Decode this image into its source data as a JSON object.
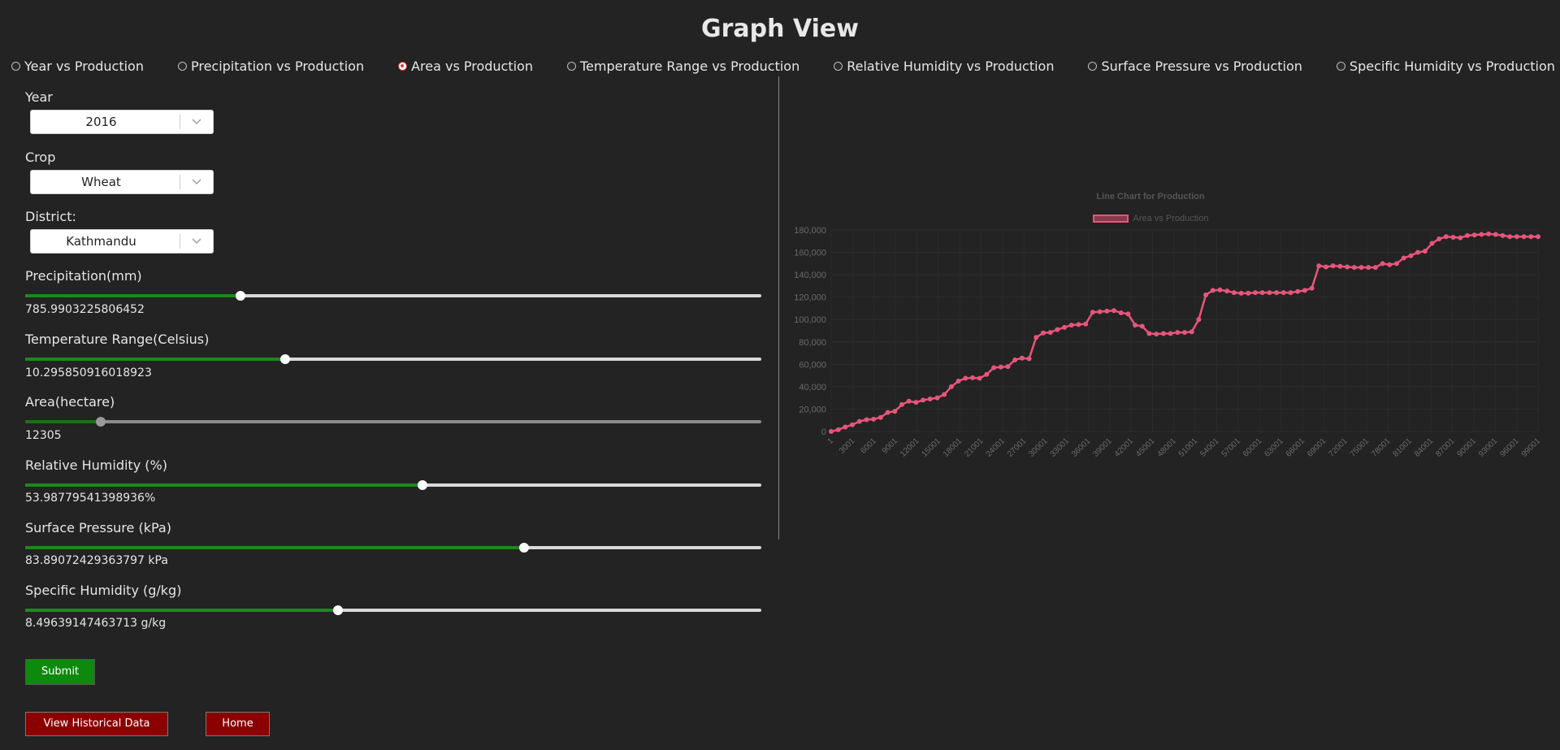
{
  "page": {
    "title": "Graph View"
  },
  "radio_options": [
    {
      "label": "Year vs Production",
      "selected": false
    },
    {
      "label": "Precipitation vs Production",
      "selected": false
    },
    {
      "label": "Area vs Production",
      "selected": true
    },
    {
      "label": "Temperature Range vs Production",
      "selected": false
    },
    {
      "label": "Relative Humidity vs Production",
      "selected": false
    },
    {
      "label": "Surface Pressure vs Production",
      "selected": false
    },
    {
      "label": "Specific Humidity vs Production",
      "selected": false
    }
  ],
  "filters": {
    "year": {
      "label": "Year",
      "value": "2016"
    },
    "crop": {
      "label": "Crop",
      "value": "Wheat"
    },
    "district": {
      "label": "District:",
      "value": "Kathmandu"
    }
  },
  "sliders": {
    "precipitation": {
      "label": "Precipitation(mm)",
      "value_text": "785.9903225806452",
      "fraction": 0.292
    },
    "temperature": {
      "label": "Temperature Range(Celsius)",
      "value_text": "10.295850916018923",
      "fraction": 0.353
    },
    "area": {
      "label": "Area(hectare)",
      "value_text": "12305",
      "fraction": 0.103
    },
    "relative_humidity": {
      "label": "Relative Humidity (%)",
      "value_text": "53.98779541398936%",
      "fraction": 0.54
    },
    "surface_pressure": {
      "label": "Surface Pressure (kPa)",
      "value_text": "83.89072429363797 kPa",
      "fraction": 0.678
    },
    "specific_humidity": {
      "label": "Specific Humidity (g/kg)",
      "value_text": "8.49639147463713 g/kg",
      "fraction": 0.425
    }
  },
  "buttons": {
    "submit": "Submit",
    "historical": "View Historical Data",
    "home": "Home"
  },
  "colors": {
    "accent_green": "#1a8a1a",
    "button_red": "#8b0000",
    "series_line": "#e8557a",
    "background": "#232323"
  },
  "icons": {
    "select_arrow": "chevron-down-icon"
  },
  "chart_data": {
    "type": "line",
    "title": "Line Chart for Production",
    "legend": "top-center",
    "grid": true,
    "x_tick_labels": [
      "1",
      "3001",
      "6001",
      "9001",
      "12001",
      "15001",
      "18001",
      "21001",
      "24001",
      "27001",
      "30001",
      "33001",
      "36001",
      "39001",
      "42001",
      "45001",
      "48001",
      "51001",
      "54001",
      "57001",
      "60001",
      "63001",
      "66001",
      "69001",
      "72001",
      "75001",
      "78001",
      "81001",
      "84001",
      "87001",
      "90001",
      "93001",
      "96001",
      "99001"
    ],
    "ylim": [
      0,
      180000
    ],
    "y_ticks": [
      0,
      20000,
      40000,
      60000,
      80000,
      100000,
      120000,
      140000,
      160000,
      180000
    ],
    "y_tick_labels": [
      "0",
      "20,000",
      "40,000",
      "60,000",
      "80,000",
      "100,000",
      "120,000",
      "140,000",
      "160,000",
      "180,000"
    ],
    "series": [
      {
        "name": "Area vs Production",
        "x": [
          1,
          1000,
          2000,
          3000,
          4000,
          5000,
          6000,
          7000,
          8000,
          9000,
          10000,
          11000,
          12000,
          13000,
          14000,
          15000,
          16000,
          17000,
          18000,
          19000,
          20000,
          21000,
          22000,
          23000,
          24000,
          25000,
          26000,
          27000,
          28000,
          29000,
          30000,
          31000,
          32000,
          33000,
          34000,
          35000,
          36000,
          37000,
          38000,
          39000,
          40000,
          41000,
          42000,
          43000,
          44000,
          45000,
          46000,
          47000,
          48000,
          49000,
          50000,
          51000,
          52000,
          53000,
          54000,
          55000,
          56000,
          57000,
          58000,
          59000,
          60000,
          61000,
          62000,
          63000,
          64000,
          65000,
          66000,
          67000,
          68000,
          69000,
          70000,
          71000,
          72000,
          73000,
          74000,
          75000,
          76000,
          77000,
          78000,
          79000,
          80000,
          81000,
          82000,
          83000,
          84000,
          85000,
          86000,
          87000,
          88000,
          89000,
          90000,
          91000,
          92000,
          93000,
          94000,
          95000,
          96000,
          97000,
          98000,
          99000,
          100000
        ],
        "y": [
          0,
          1500,
          4000,
          6000,
          9000,
          10500,
          11000,
          12500,
          17000,
          18000,
          24000,
          27000,
          26000,
          28000,
          29000,
          30000,
          33000,
          40000,
          45000,
          47500,
          48000,
          47500,
          51000,
          57000,
          57500,
          58000,
          64000,
          65500,
          65000,
          84000,
          88000,
          88500,
          91000,
          93000,
          95000,
          95500,
          96000,
          106500,
          107000,
          107500,
          108000,
          106000,
          105000,
          95000,
          94000,
          87500,
          87000,
          87500,
          87500,
          88500,
          88500,
          89000,
          100000,
          122000,
          126000,
          126500,
          125500,
          124000,
          123500,
          123500,
          124000,
          124000,
          124000,
          124000,
          124000,
          124000,
          125000,
          126000,
          128000,
          148000,
          147000,
          148000,
          147500,
          147000,
          146500,
          146500,
          146500,
          146500,
          150000,
          149000,
          150000,
          155000,
          157000,
          160000,
          161000,
          168000,
          172000,
          174000,
          173500,
          173000,
          175000,
          175500,
          176000,
          176500,
          176000,
          175000,
          174000,
          174000,
          174000,
          174000,
          174000
        ]
      }
    ]
  }
}
